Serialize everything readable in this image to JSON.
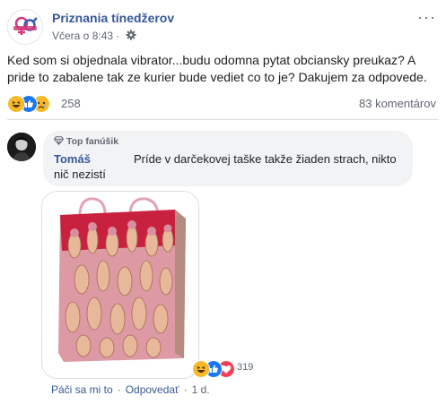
{
  "post": {
    "page_name": "Priznania tínedžerov",
    "time": "Včera o 8:43 ·",
    "more_label": "···",
    "text": "Ked som si objednala vibrator...budu odomna pytat obciansky preukaz? A pride to zabalene tak ze kurier bude vediet co to je? Dakujem za odpovede.",
    "reaction_icons": [
      "haha-icon",
      "like-icon",
      "sad-icon"
    ],
    "reaction_count": "258",
    "comments_count": "83 komentárov"
  },
  "comment": {
    "badge": "Top fanúšik",
    "author": "Tomáš",
    "text_line1": "Príde v darčekovej taške takže žiaden strach, nikto",
    "text_line2": "nič nezistí",
    "reaction_icons": [
      "haha-icon",
      "like-icon",
      "love-icon"
    ],
    "reaction_count": "319",
    "actions": {
      "like": "Páči sa mi to",
      "reply": "Odpovedať",
      "time": "1 d."
    }
  },
  "colors": {
    "link_blue": "#385898",
    "meta_grey": "#606770",
    "bubble_bg": "#f2f3f5"
  }
}
